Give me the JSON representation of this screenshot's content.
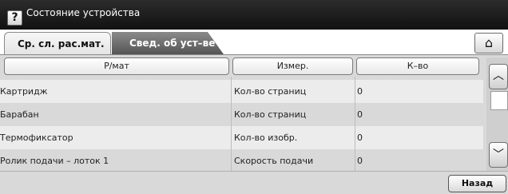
{
  "window": {
    "title": "Состояние устройства",
    "help_label": "?"
  },
  "tabs": [
    {
      "label": "Ср. сл. рас.мат.",
      "active": true
    },
    {
      "label": "Свед. об уст–ве",
      "active": false
    }
  ],
  "home_icon": "⌂",
  "table": {
    "columns": [
      "Р/мат",
      "Измер.",
      "К–во"
    ],
    "rows": [
      {
        "item": "Картридж",
        "unit": "Кол-во страниц",
        "count": "0"
      },
      {
        "item": "Барабан",
        "unit": "Кол-во страниц",
        "count": "0"
      },
      {
        "item": "Термофиксатор",
        "unit": "Кол-во изобр.",
        "count": "0"
      },
      {
        "item": "Ролик подачи – лоток 1",
        "unit": "Скорость подачи",
        "count": "0"
      }
    ]
  },
  "scroll": {
    "up_icon": "︿",
    "down_icon": "﹀"
  },
  "footer": {
    "back_label": "Назад"
  },
  "colors": {
    "titlebar": "#1a1a1a",
    "panel": "#d9d9d9",
    "row_light": "#ececec"
  }
}
